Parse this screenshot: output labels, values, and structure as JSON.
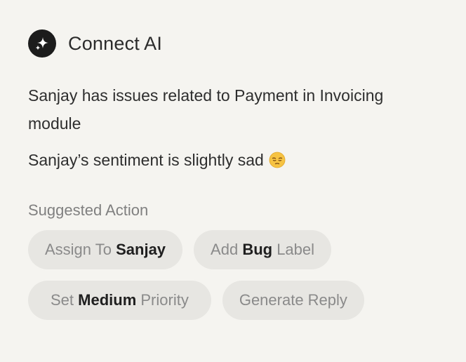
{
  "header": {
    "title": "Connect AI",
    "logo_icon": "sparkles-icon"
  },
  "insights": {
    "summary": "Sanjay has issues related to Payment in Invoicing module",
    "sentiment": "Sanjay’s sentiment is slightly sad",
    "sentiment_icon": "pensive-face-emoji"
  },
  "suggested": {
    "label": "Suggested Action",
    "actions": [
      {
        "pre": "Assign To ",
        "strong": "Sanjay",
        "post": ""
      },
      {
        "pre": "Add ",
        "strong": "Bug",
        "post": " Label"
      },
      {
        "pre": "Set ",
        "strong": "Medium",
        "post": " Priority"
      },
      {
        "pre": "Generate Reply",
        "strong": "",
        "post": ""
      }
    ]
  },
  "colors": {
    "background": "#f5f4f0",
    "chip": "#e7e6e2",
    "muted_text": "#808080",
    "primary_text": "#2b2b2b"
  }
}
